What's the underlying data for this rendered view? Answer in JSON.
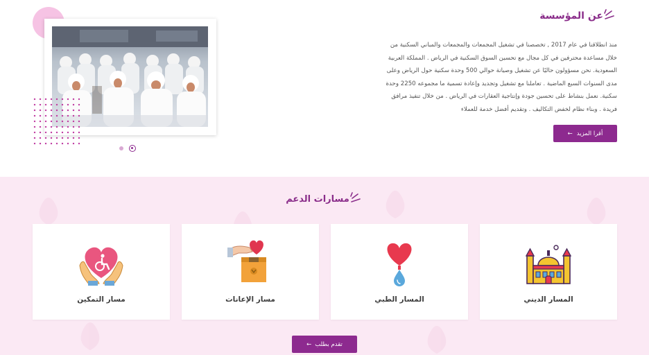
{
  "about": {
    "title": "عن المؤسسة",
    "paragraph_lines": [
      "منذ انطلاقنا في عام 2017 , تخصصنا في تشغيل المجمعات والمجمعات والمباني السكنية من",
      "خلال مساعدة محترفين في كل مجال مع تحسين السوق السكنية في الرياض . المملكة العربية",
      "السعودية. نحن مسؤولون حاليًا عن تشغيل وصيانة حوالي 500 وحدة سكنية حول الرياض وعلى",
      "مدى السنوات السبع الماضية . تعاملنا مع تشغيل وتجديد وإعادة تسمية ما مجموعه 2250 وحدة",
      "سكنية. نعمل بنشاط على تحسين جودة وإنتاجية العقارات في الرياض . من خلال تنفيذ مرافق",
      "فريدة . وبناء نظام لخفض التكاليف . وتقديم أفضل خدمة للعملاء"
    ],
    "read_more_label": "أقرا المزيد",
    "arrow": "←",
    "carousel_count": 2,
    "carousel_active": 2
  },
  "support": {
    "title": "مسارات الدعم",
    "cards": [
      {
        "label": "مسار التمكين",
        "icon": "hands-heart-wheelchair-icon"
      },
      {
        "label": "مسار الإعانات",
        "icon": "donation-box-icon"
      },
      {
        "label": "المسار الطبي",
        "icon": "heart-drop-icon"
      },
      {
        "label": "المسار الديني",
        "icon": "mosque-icon"
      }
    ],
    "submit_label": "تقدم بطلب",
    "arrow": "←"
  },
  "colors": {
    "brand_purple": "#8d2a8f",
    "section_pink": "#fbe9f4",
    "accent_pink": "#f6c3e4"
  }
}
